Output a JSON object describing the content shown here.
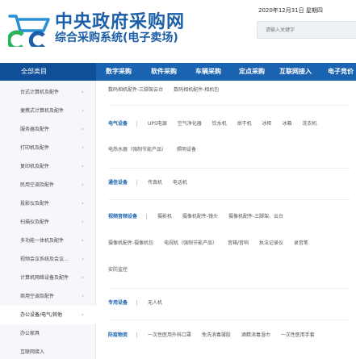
{
  "header": {
    "title": "中央政府采购网",
    "subtitle": "综合采购系统(电子卖场)",
    "date": "2020年12月31日 星期四",
    "search_placeholder": "请输入关键字"
  },
  "nav": {
    "all_categories": "全部类目",
    "items": [
      "数字采购",
      "软件采购",
      "车辆采购",
      "定点采购",
      "互联网接入",
      "电子竞价"
    ]
  },
  "sidebar": {
    "items": [
      {
        "label": "台式计算机及配件"
      },
      {
        "label": "便携式计算机及配件"
      },
      {
        "label": "服务器及配件"
      },
      {
        "label": "打印机及配件"
      },
      {
        "label": "复印机及配件"
      },
      {
        "label": "民用空调及配件"
      },
      {
        "label": "投影仪及配件"
      },
      {
        "label": "扫描仪及配件"
      },
      {
        "label": "多功能一体机及配件"
      },
      {
        "label": "视频会议系统及会议…"
      },
      {
        "label": "计算机网络设备及配件"
      },
      {
        "label": "商用空调及配件"
      },
      {
        "label": "办公设备/电气/其他"
      },
      {
        "label": "办公家具"
      },
      {
        "label": "互联网接入"
      }
    ],
    "chevron": "›"
  },
  "content": {
    "top_line": [
      "数码相机配件-三脚架云台",
      "数码相机配件-相机包"
    ],
    "electrical": {
      "title": "电气设备",
      "row1": [
        "UPS电源",
        "空气净化器",
        "饮水机",
        "烘干机",
        "冰柜",
        "冰箱",
        "洗衣机"
      ],
      "row2": [
        "电热水器（强制节能产品）",
        "照明设备"
      ]
    },
    "communication": {
      "title": "通信设备",
      "row1": [
        "传真机",
        "电话机"
      ]
    },
    "av": {
      "title": "视频音频设备",
      "row1": [
        "摄影机",
        "摄像机配件-镜头",
        "摄像机配件-三脚架、云台"
      ],
      "row2": [
        "摄像机配件-摄像机包",
        "电视机（强制节能产品）",
        "音箱/音响",
        "执法记录仪",
        "录音笔"
      ],
      "row3": [
        "安防监控"
      ]
    },
    "special": {
      "title": "专用设备",
      "row1": [
        "无人机"
      ]
    },
    "protective": {
      "title": "防疫物资",
      "row1": [
        "一次性医用外科口罩",
        "免洗消毒凝胶",
        "酒精消毒湿巾",
        "一次性医用手套"
      ]
    }
  },
  "colors": {
    "brand_blue": "#1b5fa8",
    "nav_blue": "#1a63b0",
    "logo_green": "#2bb35a"
  }
}
